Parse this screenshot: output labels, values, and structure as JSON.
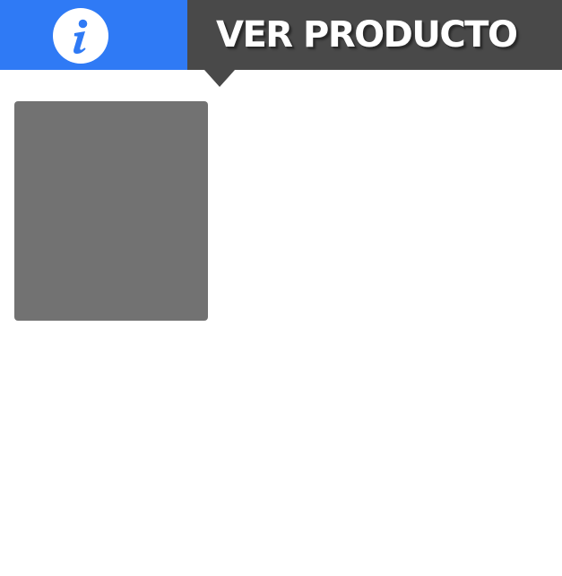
{
  "header": {
    "info_icon": "info-icon",
    "title": "VER PRODUCTO"
  },
  "colors": {
    "info_background": "#2f7af5",
    "title_background": "#494949",
    "image_placeholder": "#727272",
    "page_background": "#ffffff"
  }
}
